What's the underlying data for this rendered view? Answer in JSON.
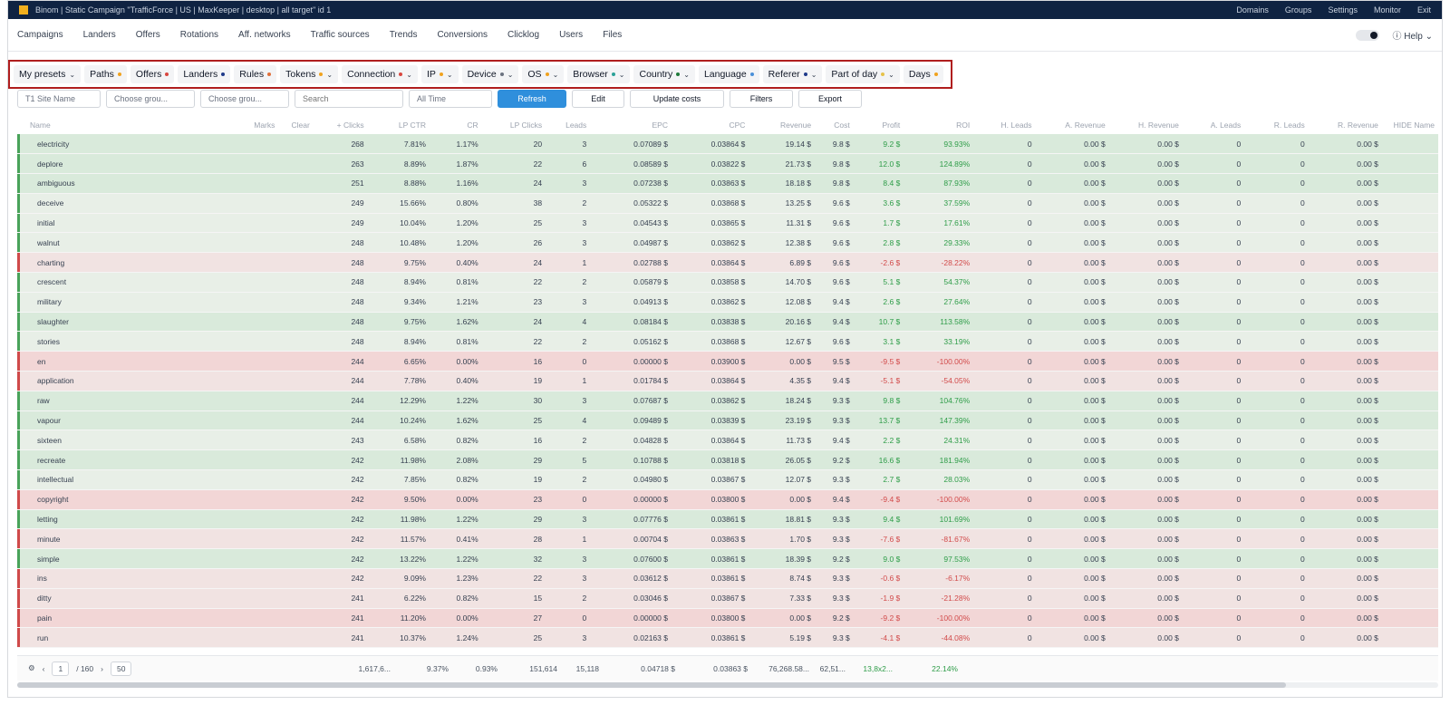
{
  "topbar": {
    "breadcrumb": "Binom | Static Campaign \"TrafficForce | US | MaxKeeper | desktop | all target\" id 1",
    "menu": [
      "Domains",
      "Groups",
      "Settings",
      "Monitor",
      "Exit"
    ]
  },
  "nav": {
    "items": [
      "Campaigns",
      "Landers",
      "Offers",
      "Rotations",
      "Aff. networks",
      "Traffic sources",
      "Trends",
      "Conversions",
      "Clicklog",
      "Users",
      "Files"
    ],
    "help": "Help"
  },
  "report_tabs": [
    {
      "label": "My presets",
      "dot": "",
      "chevron": true
    },
    {
      "label": "Paths",
      "dot": "#f0a21e",
      "chevron": false
    },
    {
      "label": "Offers",
      "dot": "#d9463f",
      "chevron": false
    },
    {
      "label": "Landers",
      "dot": "#1e3a8a",
      "chevron": false
    },
    {
      "label": "Rules",
      "dot": "#e0703a",
      "chevron": false
    },
    {
      "label": "Tokens",
      "dot": "#f0a21e",
      "chevron": true
    },
    {
      "label": "Connection",
      "dot": "#d9463f",
      "chevron": true
    },
    {
      "label": "IP",
      "dot": "#f0a21e",
      "chevron": true
    },
    {
      "label": "Device",
      "dot": "#6b7280",
      "chevron": true
    },
    {
      "label": "OS",
      "dot": "#f0a21e",
      "chevron": true
    },
    {
      "label": "Browser",
      "dot": "#2aa198",
      "chevron": true
    },
    {
      "label": "Country",
      "dot": "#1f7a3a",
      "chevron": true
    },
    {
      "label": "Language",
      "dot": "#4a90d9",
      "chevron": false
    },
    {
      "label": "Referer",
      "dot": "#1e3a8a",
      "chevron": true
    },
    {
      "label": "Part of day",
      "dot": "#e6c24a",
      "chevron": true
    },
    {
      "label": "Days",
      "dot": "#f0a21e",
      "chevron": false
    }
  ],
  "filters": {
    "group1": "T1 Site Name",
    "group2": "Choose grou...",
    "group3": "Choose grou...",
    "search_placeholder": "Search",
    "date": "All Time",
    "refresh": "Refresh",
    "edit": "Edit",
    "update_costs": "Update costs",
    "filters": "Filters",
    "export": "Export"
  },
  "table": {
    "columns": [
      "Name",
      "Marks",
      "Clear",
      "+ Clicks",
      "LP CTR",
      "CR",
      "LP Clicks",
      "Leads",
      "EPC",
      "CPC",
      "Revenue",
      "Cost",
      "Profit",
      "ROI",
      "H. Leads",
      "A. Revenue",
      "H. Revenue",
      "A. Leads",
      "R. Leads",
      "R. Revenue",
      "HIDE Name"
    ],
    "rows": [
      {
        "cls": "g",
        "name": "electricity",
        "clicks": "268",
        "lpctr": "7.81%",
        "cr": "1.17%",
        "lpclicks": "20",
        "leads": "3",
        "epc": "0.07089 $",
        "cpc": "0.03864 $",
        "revenue": "19.14 $",
        "cost": "9.8 $",
        "profit": "9.2 $",
        "roi": "93.93%"
      },
      {
        "cls": "g",
        "name": "deplore",
        "clicks": "263",
        "lpctr": "8.89%",
        "cr": "1.87%",
        "lpclicks": "22",
        "leads": "6",
        "epc": "0.08589 $",
        "cpc": "0.03822 $",
        "revenue": "21.73 $",
        "cost": "9.8 $",
        "profit": "12.0 $",
        "roi": "124.89%"
      },
      {
        "cls": "g",
        "name": "ambiguous",
        "clicks": "251",
        "lpctr": "8.88%",
        "cr": "1.16%",
        "lpclicks": "24",
        "leads": "3",
        "epc": "0.07238 $",
        "cpc": "0.03863 $",
        "revenue": "18.18 $",
        "cost": "9.8 $",
        "profit": "8.4 $",
        "roi": "87.93%"
      },
      {
        "cls": "lg",
        "name": "deceive",
        "clicks": "249",
        "lpctr": "15.66%",
        "cr": "0.80%",
        "lpclicks": "38",
        "leads": "2",
        "epc": "0.05322 $",
        "cpc": "0.03868 $",
        "revenue": "13.25 $",
        "cost": "9.6 $",
        "profit": "3.6 $",
        "roi": "37.59%"
      },
      {
        "cls": "lg",
        "name": "initial",
        "clicks": "249",
        "lpctr": "10.04%",
        "cr": "1.20%",
        "lpclicks": "25",
        "leads": "3",
        "epc": "0.04543 $",
        "cpc": "0.03865 $",
        "revenue": "11.31 $",
        "cost": "9.6 $",
        "profit": "1.7 $",
        "roi": "17.61%"
      },
      {
        "cls": "lg",
        "name": "walnut",
        "clicks": "248",
        "lpctr": "10.48%",
        "cr": "1.20%",
        "lpclicks": "26",
        "leads": "3",
        "epc": "0.04987 $",
        "cpc": "0.03862 $",
        "revenue": "12.38 $",
        "cost": "9.6 $",
        "profit": "2.8 $",
        "roi": "29.33%"
      },
      {
        "cls": "lr",
        "name": "charting",
        "clicks": "248",
        "lpctr": "9.75%",
        "cr": "0.40%",
        "lpclicks": "24",
        "leads": "1",
        "epc": "0.02788 $",
        "cpc": "0.03864 $",
        "revenue": "6.89 $",
        "cost": "9.6 $",
        "profit": "-2.6 $",
        "roi": "-28.22%"
      },
      {
        "cls": "lg",
        "name": "crescent",
        "clicks": "248",
        "lpctr": "8.94%",
        "cr": "0.81%",
        "lpclicks": "22",
        "leads": "2",
        "epc": "0.05879 $",
        "cpc": "0.03858 $",
        "revenue": "14.70 $",
        "cost": "9.6 $",
        "profit": "5.1 $",
        "roi": "54.37%"
      },
      {
        "cls": "lg",
        "name": "military",
        "clicks": "248",
        "lpctr": "9.34%",
        "cr": "1.21%",
        "lpclicks": "23",
        "leads": "3",
        "epc": "0.04913 $",
        "cpc": "0.03862 $",
        "revenue": "12.08 $",
        "cost": "9.4 $",
        "profit": "2.6 $",
        "roi": "27.64%"
      },
      {
        "cls": "g",
        "name": "slaughter",
        "clicks": "248",
        "lpctr": "9.75%",
        "cr": "1.62%",
        "lpclicks": "24",
        "leads": "4",
        "epc": "0.08184 $",
        "cpc": "0.03838 $",
        "revenue": "20.16 $",
        "cost": "9.4 $",
        "profit": "10.7 $",
        "roi": "113.58%"
      },
      {
        "cls": "lg",
        "name": "stories",
        "clicks": "248",
        "lpctr": "8.94%",
        "cr": "0.81%",
        "lpclicks": "22",
        "leads": "2",
        "epc": "0.05162 $",
        "cpc": "0.03868 $",
        "revenue": "12.67 $",
        "cost": "9.6 $",
        "profit": "3.1 $",
        "roi": "33.19%"
      },
      {
        "cls": "r",
        "name": "en",
        "clicks": "244",
        "lpctr": "6.65%",
        "cr": "0.00%",
        "lpclicks": "16",
        "leads": "0",
        "epc": "0.00000 $",
        "cpc": "0.03900 $",
        "revenue": "0.00 $",
        "cost": "9.5 $",
        "profit": "-9.5 $",
        "roi": "-100.00%"
      },
      {
        "cls": "lr",
        "name": "application",
        "clicks": "244",
        "lpctr": "7.78%",
        "cr": "0.40%",
        "lpclicks": "19",
        "leads": "1",
        "epc": "0.01784 $",
        "cpc": "0.03864 $",
        "revenue": "4.35 $",
        "cost": "9.4 $",
        "profit": "-5.1 $",
        "roi": "-54.05%"
      },
      {
        "cls": "g",
        "name": "raw",
        "clicks": "244",
        "lpctr": "12.29%",
        "cr": "1.22%",
        "lpclicks": "30",
        "leads": "3",
        "epc": "0.07687 $",
        "cpc": "0.03862 $",
        "revenue": "18.24 $",
        "cost": "9.3 $",
        "profit": "9.8 $",
        "roi": "104.76%"
      },
      {
        "cls": "g",
        "name": "vapour",
        "clicks": "244",
        "lpctr": "10.24%",
        "cr": "1.62%",
        "lpclicks": "25",
        "leads": "4",
        "epc": "0.09489 $",
        "cpc": "0.03839 $",
        "revenue": "23.19 $",
        "cost": "9.3 $",
        "profit": "13.7 $",
        "roi": "147.39%"
      },
      {
        "cls": "lg",
        "name": "sixteen",
        "clicks": "243",
        "lpctr": "6.58%",
        "cr": "0.82%",
        "lpclicks": "16",
        "leads": "2",
        "epc": "0.04828 $",
        "cpc": "0.03864 $",
        "revenue": "11.73 $",
        "cost": "9.4 $",
        "profit": "2.2 $",
        "roi": "24.31%"
      },
      {
        "cls": "g",
        "name": "recreate",
        "clicks": "242",
        "lpctr": "11.98%",
        "cr": "2.08%",
        "lpclicks": "29",
        "leads": "5",
        "epc": "0.10788 $",
        "cpc": "0.03818 $",
        "revenue": "26.05 $",
        "cost": "9.2 $",
        "profit": "16.6 $",
        "roi": "181.94%"
      },
      {
        "cls": "lg",
        "name": "intellectual",
        "clicks": "242",
        "lpctr": "7.85%",
        "cr": "0.82%",
        "lpclicks": "19",
        "leads": "2",
        "epc": "0.04980 $",
        "cpc": "0.03867 $",
        "revenue": "12.07 $",
        "cost": "9.3 $",
        "profit": "2.7 $",
        "roi": "28.03%"
      },
      {
        "cls": "r",
        "name": "copyright",
        "clicks": "242",
        "lpctr": "9.50%",
        "cr": "0.00%",
        "lpclicks": "23",
        "leads": "0",
        "epc": "0.00000 $",
        "cpc": "0.03800 $",
        "revenue": "0.00 $",
        "cost": "9.4 $",
        "profit": "-9.4 $",
        "roi": "-100.00%"
      },
      {
        "cls": "g",
        "name": "letting",
        "clicks": "242",
        "lpctr": "11.98%",
        "cr": "1.22%",
        "lpclicks": "29",
        "leads": "3",
        "epc": "0.07776 $",
        "cpc": "0.03861 $",
        "revenue": "18.81 $",
        "cost": "9.3 $",
        "profit": "9.4 $",
        "roi": "101.69%"
      },
      {
        "cls": "lr",
        "name": "minute",
        "clicks": "242",
        "lpctr": "11.57%",
        "cr": "0.41%",
        "lpclicks": "28",
        "leads": "1",
        "epc": "0.00704 $",
        "cpc": "0.03863 $",
        "revenue": "1.70 $",
        "cost": "9.3 $",
        "profit": "-7.6 $",
        "roi": "-81.67%"
      },
      {
        "cls": "g",
        "name": "simple",
        "clicks": "242",
        "lpctr": "13.22%",
        "cr": "1.22%",
        "lpclicks": "32",
        "leads": "3",
        "epc": "0.07600 $",
        "cpc": "0.03861 $",
        "revenue": "18.39 $",
        "cost": "9.2 $",
        "profit": "9.0 $",
        "roi": "97.53%"
      },
      {
        "cls": "lr",
        "name": "ins",
        "clicks": "242",
        "lpctr": "9.09%",
        "cr": "1.23%",
        "lpclicks": "22",
        "leads": "3",
        "epc": "0.03612 $",
        "cpc": "0.03861 $",
        "revenue": "8.74 $",
        "cost": "9.3 $",
        "profit": "-0.6 $",
        "roi": "-6.17%"
      },
      {
        "cls": "lr",
        "name": "ditty",
        "clicks": "241",
        "lpctr": "6.22%",
        "cr": "0.82%",
        "lpclicks": "15",
        "leads": "2",
        "epc": "0.03046 $",
        "cpc": "0.03867 $",
        "revenue": "7.33 $",
        "cost": "9.3 $",
        "profit": "-1.9 $",
        "roi": "-21.28%"
      },
      {
        "cls": "r",
        "name": "pain",
        "clicks": "241",
        "lpctr": "11.20%",
        "cr": "0.00%",
        "lpclicks": "27",
        "leads": "0",
        "epc": "0.00000 $",
        "cpc": "0.03800 $",
        "revenue": "0.00 $",
        "cost": "9.2 $",
        "profit": "-9.2 $",
        "roi": "-100.00%"
      },
      {
        "cls": "lr",
        "name": "run",
        "clicks": "241",
        "lpctr": "10.37%",
        "cr": "1.24%",
        "lpclicks": "25",
        "leads": "3",
        "epc": "0.02163 $",
        "cpc": "0.03861 $",
        "revenue": "5.19 $",
        "cost": "9.3 $",
        "profit": "-4.1 $",
        "roi": "-44.08%"
      }
    ],
    "zero_count": "0",
    "zero_money": "0.00 $"
  },
  "footer": {
    "page": "1",
    "pages": "160",
    "per_page": "50",
    "clicks": "1,617,6...",
    "lpctr": "9.37%",
    "cr": "0.93%",
    "lpclicks": "151,614",
    "leads": "15,118",
    "epc": "0.04718 $",
    "cpc": "0.03863 $",
    "revenue": "76,268.58...",
    "cost": "62,51...",
    "profit": "13,8x2...",
    "roi": "22.14%"
  }
}
